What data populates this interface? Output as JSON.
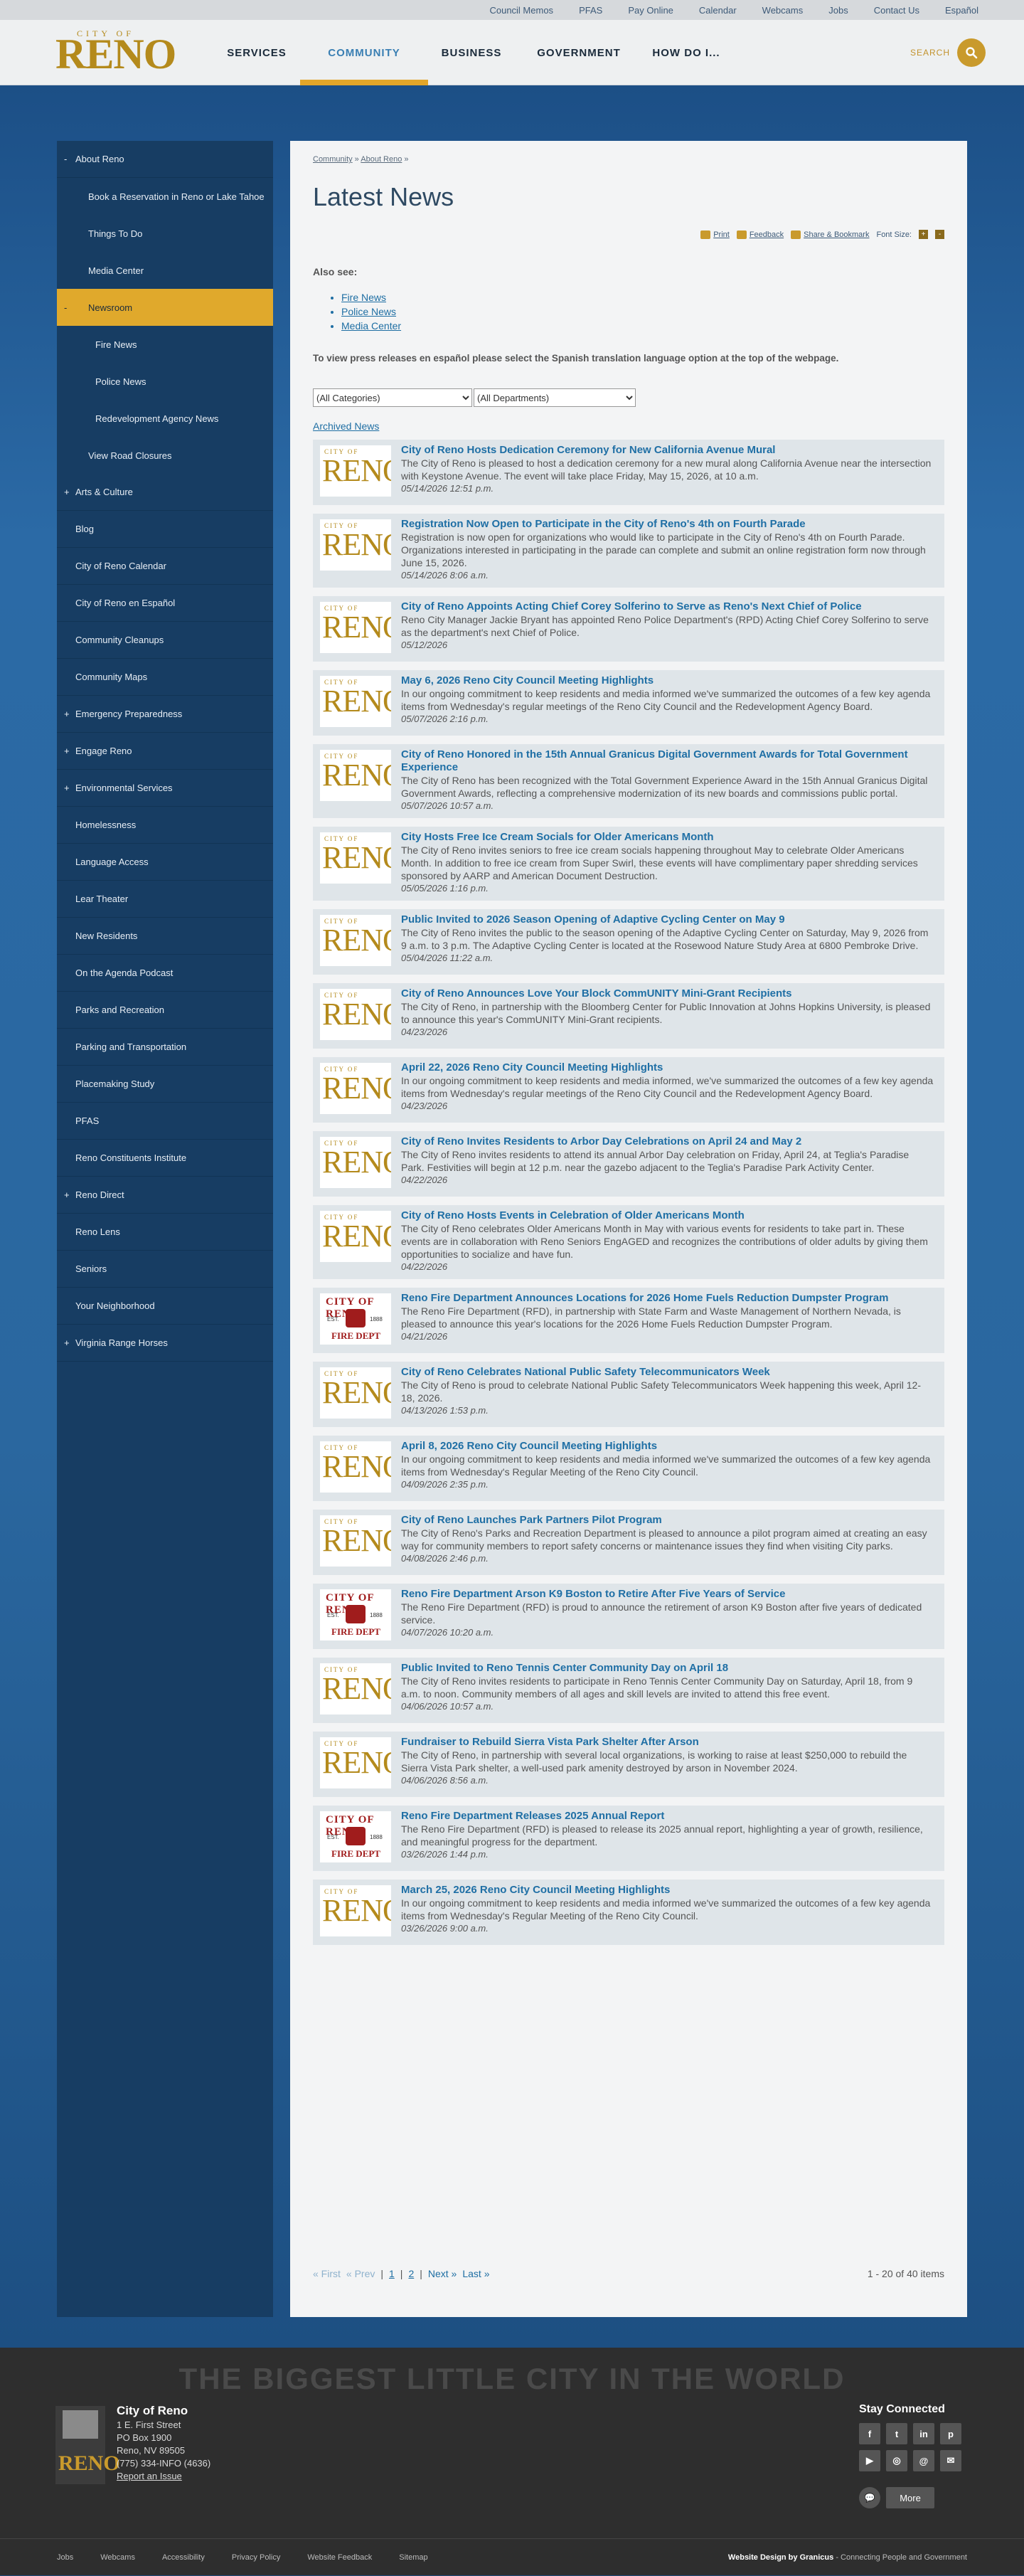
{
  "utility": [
    "Council Memos",
    "PFAS",
    "Pay Online",
    "Calendar",
    "Webcams",
    "Jobs",
    "Contact Us",
    "Español"
  ],
  "logo": {
    "city_of": "CITY OF",
    "reno": "RENO"
  },
  "nav": [
    {
      "label": "SERVICES",
      "active": false
    },
    {
      "label": "COMMUNITY",
      "active": true
    },
    {
      "label": "BUSINESS",
      "active": false
    },
    {
      "label": "GOVERNMENT",
      "active": false
    },
    {
      "label": "HOW DO I...",
      "active": false
    }
  ],
  "search_label": "SEARCH",
  "sidebar": [
    {
      "label": "About Reno",
      "level": "top",
      "pm": "-",
      "active": false
    },
    {
      "label": "Book a Reservation in Reno or Lake Tahoe",
      "level": "sub",
      "pm": "",
      "active": false
    },
    {
      "label": "Things To Do",
      "level": "sub",
      "pm": "",
      "active": false
    },
    {
      "label": "Media Center",
      "level": "sub",
      "pm": "",
      "active": false
    },
    {
      "label": "Newsroom",
      "level": "sub",
      "pm": "-",
      "active": true
    },
    {
      "label": "Fire News",
      "level": "sub2",
      "pm": "",
      "active": false
    },
    {
      "label": "Police News",
      "level": "sub2",
      "pm": "",
      "active": false
    },
    {
      "label": "Redevelopment Agency News",
      "level": "sub2",
      "pm": "",
      "active": false
    },
    {
      "label": "View Road Closures",
      "level": "sub",
      "pm": "",
      "active": false
    },
    {
      "label": "Arts & Culture",
      "level": "top",
      "pm": "+",
      "active": false
    },
    {
      "label": "Blog",
      "level": "top",
      "pm": "",
      "active": false
    },
    {
      "label": "City of Reno Calendar",
      "level": "top",
      "pm": "",
      "active": false
    },
    {
      "label": "City of Reno en Español",
      "level": "top",
      "pm": "",
      "active": false
    },
    {
      "label": "Community Cleanups",
      "level": "top",
      "pm": "",
      "active": false
    },
    {
      "label": "Community Maps",
      "level": "top",
      "pm": "",
      "active": false
    },
    {
      "label": "Emergency Preparedness",
      "level": "top",
      "pm": "+",
      "active": false
    },
    {
      "label": "Engage Reno",
      "level": "top",
      "pm": "+",
      "active": false
    },
    {
      "label": "Environmental Services",
      "level": "top",
      "pm": "+",
      "active": false
    },
    {
      "label": "Homelessness",
      "level": "top",
      "pm": "",
      "active": false
    },
    {
      "label": "Language Access",
      "level": "top",
      "pm": "",
      "active": false
    },
    {
      "label": "Lear Theater",
      "level": "top",
      "pm": "",
      "active": false
    },
    {
      "label": "New Residents",
      "level": "top",
      "pm": "",
      "active": false
    },
    {
      "label": "On the Agenda Podcast",
      "level": "top",
      "pm": "",
      "active": false
    },
    {
      "label": "Parks and Recreation",
      "level": "top",
      "pm": "",
      "active": false
    },
    {
      "label": "Parking and Transportation",
      "level": "top",
      "pm": "",
      "active": false
    },
    {
      "label": "Placemaking Study",
      "level": "top",
      "pm": "",
      "active": false
    },
    {
      "label": "PFAS",
      "level": "top",
      "pm": "",
      "active": false
    },
    {
      "label": "Reno Constituents Institute",
      "level": "top",
      "pm": "",
      "active": false
    },
    {
      "label": "Reno Direct",
      "level": "top",
      "pm": "+",
      "active": false
    },
    {
      "label": "Reno Lens",
      "level": "top",
      "pm": "",
      "active": false
    },
    {
      "label": "Seniors",
      "level": "top",
      "pm": "",
      "active": false
    },
    {
      "label": "Your Neighborhood",
      "level": "top",
      "pm": "",
      "active": false
    },
    {
      "label": "Virginia Range Horses",
      "level": "top",
      "pm": "+",
      "active": false
    }
  ],
  "breadcrumb": {
    "first": "Community",
    "sep": " » ",
    "second": "About Reno",
    "tail": " »"
  },
  "page_title": "Latest News",
  "tools": {
    "print": "Print",
    "feedback": "Feedback",
    "share": "Share & Bookmark",
    "font_size": "Font Size:",
    "plus": "+",
    "minus": "-"
  },
  "also_see_label": "Also see:",
  "also_see": [
    "Fire News",
    "Police News",
    "Media Center"
  ],
  "espanol_note": "To view press releases en español please select the Spanish translation language option at the top of the webpage.",
  "filters": {
    "categories": "(All Categories)",
    "departments": "(All Departments)"
  },
  "archived": "Archived News",
  "news": [
    {
      "thumb": "reno",
      "title": "City of Reno Hosts Dedication Ceremony for New California Avenue Mural",
      "summary": "The City of Reno is pleased to host a dedication ceremony for a new mural along California Avenue near the intersection with Keystone Avenue. The event will take place Friday, May 15, 2026, at 10 a.m.",
      "date": "05/14/2026 12:51 p.m."
    },
    {
      "thumb": "reno",
      "title": "Registration Now Open to Participate in the City of Reno's 4th on Fourth Parade",
      "summary": "Registration is now open for organizations who would like to participate in the City of Reno's 4th on Fourth Parade. Organizations interested in participating in the parade can complete and submit an online registration form now through June 15, 2026.",
      "date": "05/14/2026 8:06 a.m."
    },
    {
      "thumb": "reno",
      "title": "City of Reno Appoints Acting Chief Corey Solferino to Serve as Reno's Next Chief of Police",
      "summary": "Reno City Manager Jackie Bryant has appointed Reno Police Department's (RPD) Acting Chief Corey Solferino to serve as the department's next Chief of Police.",
      "date": "05/12/2026"
    },
    {
      "thumb": "reno",
      "title": "May 6, 2026 Reno City Council Meeting Highlights",
      "summary": "In our ongoing commitment to keep residents and media informed we've summarized the outcomes of a few key agenda items from Wednesday's regular meetings of the Reno City Council and the Redevelopment Agency Board.",
      "date": "05/07/2026 2:16 p.m."
    },
    {
      "thumb": "reno",
      "title": "City of Reno Honored in the 15th Annual Granicus Digital Government Awards for Total Government Experience",
      "summary": "The City of Reno has been recognized with the Total Government Experience Award in the 15th Annual Granicus Digital Government Awards, reflecting a comprehensive modernization of its new boards and commissions public portal.",
      "date": "05/07/2026 10:57 a.m."
    },
    {
      "thumb": "reno",
      "title": "City Hosts Free Ice Cream Socials for Older Americans Month",
      "summary": "The City of Reno invites seniors to free ice cream socials happening throughout May to celebrate Older Americans Month. In addition to free ice cream from Super Swirl, these events will have complimentary paper shredding services sponsored by AARP and American Document Destruction.",
      "date": "05/05/2026 1:16 p.m."
    },
    {
      "thumb": "reno",
      "title": "Public Invited to 2026 Season Opening of Adaptive Cycling Center on May 9",
      "summary": "The City of Reno invites the public to the season opening of the Adaptive Cycling Center on Saturday, May 9, 2026 from 9 a.m. to 3 p.m. The Adaptive Cycling Center is located at the Rosewood Nature Study Area at 6800 Pembroke Drive.",
      "date": "05/04/2026 11:22 a.m."
    },
    {
      "thumb": "reno",
      "title": "City of Reno Announces Love Your Block CommUNITY Mini-Grant Recipients",
      "summary": "The City of Reno, in partnership with the Bloomberg Center for Public Innovation at Johns Hopkins University, is pleased to announce this year's CommUNITY Mini-Grant recipients.",
      "date": "04/23/2026"
    },
    {
      "thumb": "reno",
      "title": "April 22, 2026 Reno City Council Meeting Highlights",
      "summary": "In our ongoing commitment to keep residents and media informed, we've summarized the outcomes of a few key agenda items from Wednesday's regular meetings of the Reno City Council and the Redevelopment Agency Board.",
      "date": "04/23/2026"
    },
    {
      "thumb": "reno",
      "title": "City of Reno Invites Residents to Arbor Day Celebrations on April 24 and May 2",
      "summary": "The City of Reno invites residents to attend its annual Arbor Day celebration on Friday, April 24, at Teglia's Paradise Park. Festivities will begin at 12 p.m. near the gazebo adjacent to the Teglia's Paradise Park Activity Center.",
      "date": "04/22/2026"
    },
    {
      "thumb": "reno",
      "title": "City of Reno Hosts Events in Celebration of Older Americans Month",
      "summary": "The City of Reno celebrates Older Americans Month in May with various events for residents to take part in. These events are in collaboration with Reno Seniors EngAGED and recognizes the contributions of older adults by giving them opportunities to socialize and have fun.",
      "date": "04/22/2026"
    },
    {
      "thumb": "fire",
      "title": "Reno Fire Department Announces Locations for 2026 Home Fuels Reduction Dumpster Program",
      "summary": "The Reno Fire Department (RFD), in partnership with State Farm and Waste Management of Northern Nevada, is pleased to announce this year's locations for the 2026 Home Fuels Reduction Dumpster Program.",
      "date": "04/21/2026"
    },
    {
      "thumb": "reno",
      "title": "City of Reno Celebrates National Public Safety Telecommunicators Week",
      "summary": "The City of Reno is proud to celebrate National Public Safety Telecommunicators Week happening this week, April 12-18, 2026.",
      "date": "04/13/2026 1:53 p.m."
    },
    {
      "thumb": "reno",
      "title": "April 8, 2026 Reno City Council Meeting Highlights",
      "summary": "In our ongoing commitment to keep residents and media informed we've summarized the outcomes of a few key agenda items from Wednesday's Regular Meeting of the Reno City Council.",
      "date": "04/09/2026 2:35 p.m."
    },
    {
      "thumb": "reno",
      "title": "City of Reno Launches Park Partners Pilot Program",
      "summary": "The City of Reno's Parks and Recreation Department is pleased to announce a pilot program aimed at creating an easy way for community members to report safety concerns or maintenance issues they find when visiting City parks.",
      "date": "04/08/2026 2:46 p.m."
    },
    {
      "thumb": "fire",
      "title": "Reno Fire Department Arson K9 Boston to Retire After Five Years of Service",
      "summary": "The Reno Fire Department (RFD) is proud to announce the retirement of arson K9 Boston after five years of dedicated service.",
      "date": "04/07/2026 10:20 a.m."
    },
    {
      "thumb": "reno",
      "title": "Public Invited to Reno Tennis Center Community Day on April 18",
      "summary": "The City of Reno invites residents to participate in Reno Tennis Center Community Day on Saturday, April 18, from 9 a.m. to noon. Community members of all ages and skill levels are invited to attend this free event.",
      "date": "04/06/2026 10:57 a.m."
    },
    {
      "thumb": "reno",
      "title": "Fundraiser to Rebuild Sierra Vista Park Shelter After Arson",
      "summary": "The City of Reno, in partnership with several local organizations, is working to raise at least $250,000 to rebuild the Sierra Vista Park shelter, a well-used park amenity destroyed by arson in November 2024.",
      "date": "04/06/2026 8:56 a.m."
    },
    {
      "thumb": "fire",
      "title": "Reno Fire Department Releases 2025 Annual Report",
      "summary": "The Reno Fire Department (RFD) is pleased to release its 2025 annual report, highlighting a year of growth, resilience, and meaningful progress for the department.",
      "date": "03/26/2026 1:44 p.m."
    },
    {
      "thumb": "reno",
      "title": "March 25, 2026 Reno City Council Meeting Highlights",
      "summary": "In our ongoing commitment to keep residents and media informed we've summarized the outcomes of a few key agenda items from Wednesday's Regular Meeting of the Reno City Council.",
      "date": "03/26/2026 9:00 a.m."
    }
  ],
  "thumb_text": {
    "city_of": "CITY OF",
    "reno": "RENO",
    "fire_city": "CITY OF RENO",
    "est": "EST.",
    "year": "1888",
    "fire_dept": "FIRE DEPT"
  },
  "pager": {
    "first": "« First",
    "prev": "« Prev",
    "p1": "1",
    "p2": "2",
    "next": "Next »",
    "last": "Last »",
    "sep": "|",
    "count": "1 - 20 of 40 items"
  },
  "footer": {
    "slogan": "THE BIGGEST LITTLE CITY IN THE WORLD",
    "name": "City of Reno",
    "addr1": "1 E. First Street",
    "addr2": "PO Box 1900",
    "addr3": "Reno, NV 89505",
    "phone": "(775) 334-INFO (4636)",
    "report": "Report an Issue",
    "logo_text": "RENO",
    "stay": "Stay Connected",
    "social": [
      "f",
      "t",
      "in",
      "p",
      "▶",
      "◎",
      "@",
      "✉"
    ],
    "more": "More",
    "links": [
      "Jobs",
      "Webcams",
      "Accessibility",
      "Privacy Policy",
      "Website Feedback",
      "Sitemap"
    ],
    "credit_a": "Website Design by Granicus",
    "credit_b": " - Connecting People and Government"
  }
}
